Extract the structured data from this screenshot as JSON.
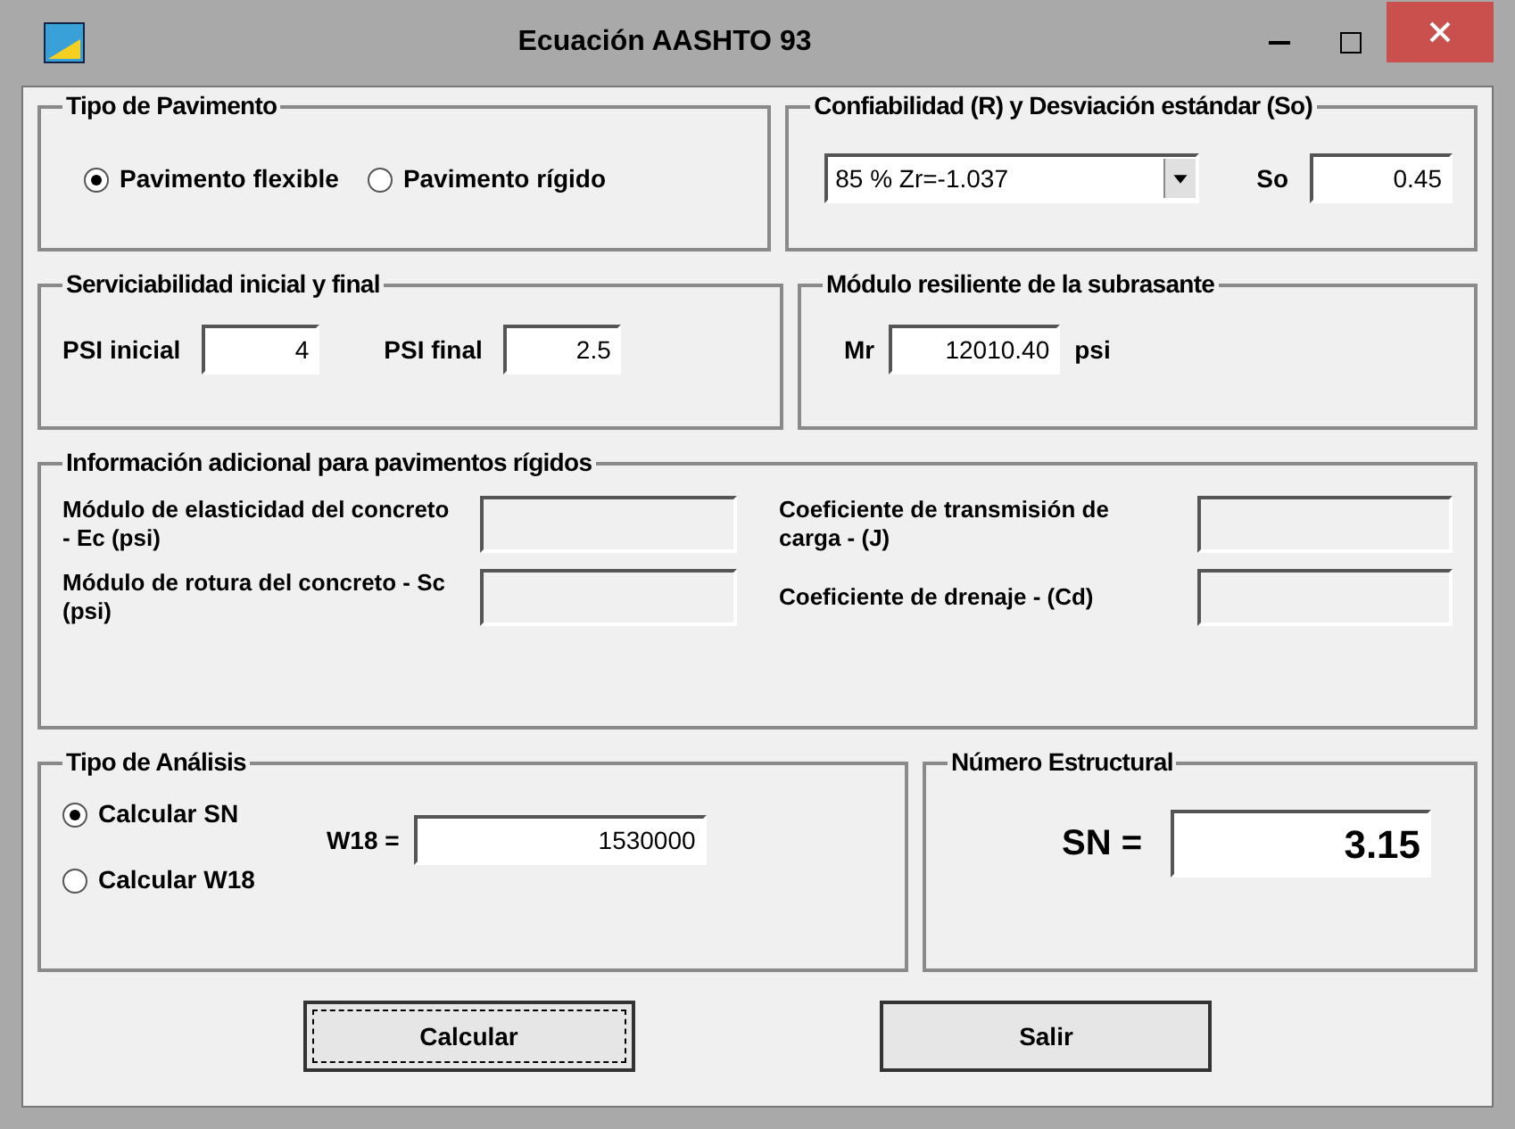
{
  "window": {
    "title": "Ecuación AASHTO 93"
  },
  "pavement_type": {
    "title": "Tipo de Pavimento",
    "options": [
      {
        "label": "Pavimento flexible",
        "selected": true
      },
      {
        "label": "Pavimento rígido",
        "selected": false
      }
    ]
  },
  "reliability": {
    "title": "Confiabilidad (R) y Desviación estándar (So)",
    "dropdown_value": "85 % Zr=-1.037",
    "so_label": "So",
    "so_value": "0.45"
  },
  "serviceability": {
    "title": "Serviciabilidad inicial y final",
    "fields": [
      {
        "label": "PSI inicial",
        "value": "4"
      },
      {
        "label": "PSI final",
        "value": "2.5"
      }
    ]
  },
  "subgrade": {
    "title": "Módulo resiliente de la subrasante",
    "label": "Mr",
    "value": "12010.40",
    "unit": "psi"
  },
  "rigid_info": {
    "title": "Información adicional para pavimentos rígidos",
    "fields": [
      {
        "label": "Módulo de elasticidad del concreto - Ec (psi)",
        "disabled": true
      },
      {
        "label": "Coeficiente de transmisión de carga - (J)",
        "disabled": true
      },
      {
        "label": "Módulo de rotura del concreto - Sc (psi)",
        "disabled": true
      },
      {
        "label": "Coeficiente de drenaje - (Cd)",
        "disabled": true
      }
    ]
  },
  "analysis_type": {
    "title": "Tipo de Análisis",
    "options": [
      {
        "label": "Calcular SN",
        "selected": true
      },
      {
        "label": "Calcular W18",
        "selected": false
      }
    ],
    "w18_label": "W18 =",
    "w18_value": "1530000"
  },
  "structural_number": {
    "title": "Número Estructural",
    "label": "SN =",
    "value": "3.15"
  },
  "buttons": [
    {
      "label": "Calcular",
      "focused": true
    },
    {
      "label": "Salir",
      "focused": false
    }
  ]
}
